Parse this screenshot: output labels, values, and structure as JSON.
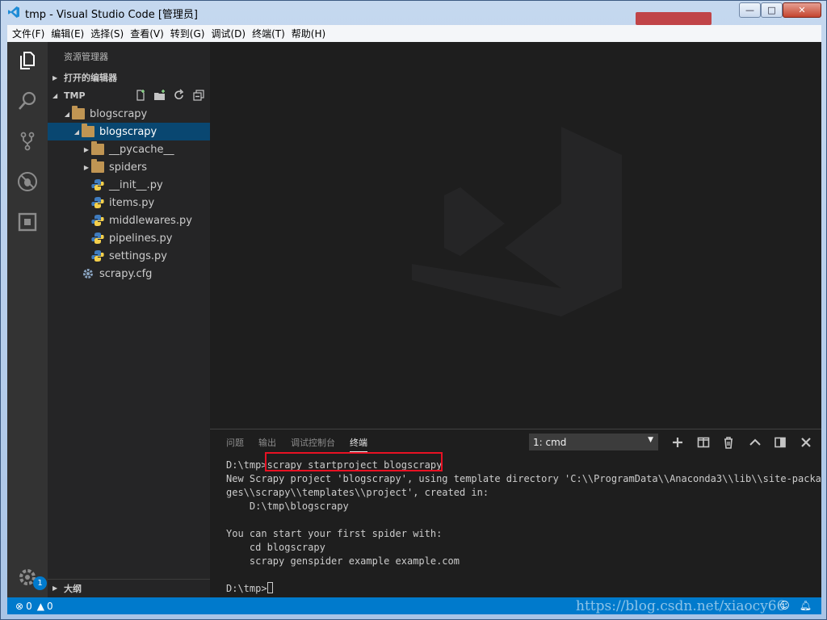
{
  "window": {
    "title": "tmp - Visual Studio Code [管理员]",
    "controls": {
      "minimize": "—",
      "maximize": "□",
      "close": "✕"
    }
  },
  "menu": [
    "文件(F)",
    "编辑(E)",
    "选择(S)",
    "查看(V)",
    "转到(G)",
    "调试(D)",
    "终端(T)",
    "帮助(H)"
  ],
  "activity_bar": {
    "icons": [
      "explorer-icon",
      "search-icon",
      "source-control-icon",
      "debug-icon",
      "extensions-icon",
      "settings-gear-icon"
    ],
    "settings_badge": "1"
  },
  "sidebar": {
    "title": "资源管理器",
    "open_editors_label": "打开的编辑器",
    "folder_label": "TMP",
    "tree": [
      {
        "label": "blogscrapy",
        "kind": "folder",
        "depth": 1,
        "expanded": true
      },
      {
        "label": "blogscrapy",
        "kind": "folder",
        "depth": 2,
        "expanded": true,
        "selected": true
      },
      {
        "label": "__pycache__",
        "kind": "folder",
        "depth": 3,
        "expanded": false
      },
      {
        "label": "spiders",
        "kind": "folder",
        "depth": 3,
        "expanded": false
      },
      {
        "label": "__init__.py",
        "kind": "python",
        "depth": 3
      },
      {
        "label": "items.py",
        "kind": "python",
        "depth": 3
      },
      {
        "label": "middlewares.py",
        "kind": "python",
        "depth": 3
      },
      {
        "label": "pipelines.py",
        "kind": "python",
        "depth": 3
      },
      {
        "label": "settings.py",
        "kind": "python",
        "depth": 3
      },
      {
        "label": "scrapy.cfg",
        "kind": "config",
        "depth": 2
      }
    ],
    "outline_label": "大纲"
  },
  "panel": {
    "tabs": [
      "问题",
      "输出",
      "调试控制台",
      "终端"
    ],
    "active_tab": "终端",
    "terminal_select": "1: cmd",
    "terminal_lines": [
      "D:\\tmp>scrapy startproject blogscrapy",
      "New Scrapy project 'blogscrapy', using template directory 'C:\\\\ProgramData\\\\Anaconda3\\\\lib\\\\site-packa",
      "ges\\\\scrapy\\\\templates\\\\project', created in:",
      "    D:\\tmp\\blogscrapy",
      "",
      "You can start your first spider with:",
      "    cd blogscrapy",
      "    scrapy genspider example example.com",
      "",
      "D:\\tmp>"
    ]
  },
  "status_bar": {
    "errors": "0",
    "warnings": "0"
  },
  "watermark": "https://blog.csdn.net/xiaocy66",
  "colors": {
    "accent": "#007acc",
    "selection": "#094771",
    "highlight_box": "#e81123"
  }
}
